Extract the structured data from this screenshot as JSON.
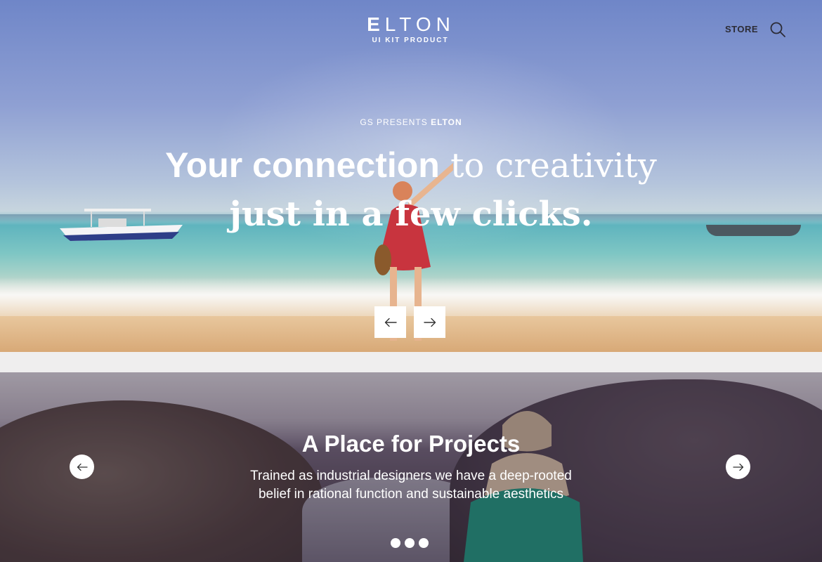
{
  "header": {
    "logo_first_letter": "E",
    "logo_rest": "LTON",
    "logo_tagline": "UI KIT PRODUCT",
    "nav_store": "STORE",
    "search_icon": "search-icon"
  },
  "hero": {
    "eyebrow_prefix": "GS PRESENTS ",
    "eyebrow_brand": "ELTON",
    "title_bold": "Your connection",
    "title_serif": " to creativity",
    "title_line2": "just in a few clicks.",
    "prev_icon": "arrow-left-icon",
    "next_icon": "arrow-right-icon"
  },
  "slider": {
    "title": "A Place for Projects",
    "text_line1": "Trained as industrial designers we have a deep-rooted",
    "text_line2": "belief in rational function and sustainable aesthetics",
    "prev_icon": "arrow-left-icon",
    "next_icon": "arrow-right-icon",
    "dot_count": 3
  },
  "colors": {
    "nav_text": "#2c2c36",
    "page_bg": "#efeeee",
    "white": "#ffffff"
  }
}
